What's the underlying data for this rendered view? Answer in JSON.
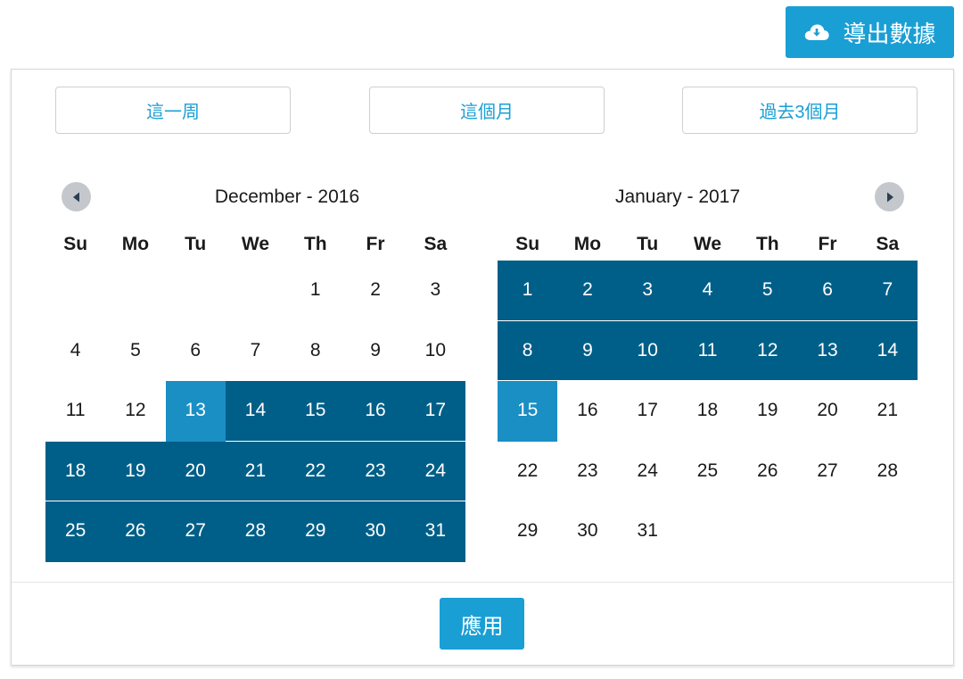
{
  "export_button": {
    "label": "導出數據",
    "icon": "cloud-download-icon"
  },
  "presets": [
    {
      "label": "這一周"
    },
    {
      "label": "這個月"
    },
    {
      "label": "過去3個月"
    }
  ],
  "nav": {
    "prev_icon": "triangle-left-icon",
    "next_icon": "triangle-right-icon"
  },
  "weekday_labels": [
    "Su",
    "Mo",
    "Tu",
    "We",
    "Th",
    "Fr",
    "Sa"
  ],
  "calendars": [
    {
      "title": "December - 2016",
      "weeks": [
        [
          "",
          "",
          "",
          "",
          "1",
          "2",
          "3"
        ],
        [
          "4",
          "5",
          "6",
          "7",
          "8",
          "9",
          "10"
        ],
        [
          "11",
          "12",
          "13",
          "14",
          "15",
          "16",
          "17"
        ],
        [
          "18",
          "19",
          "20",
          "21",
          "22",
          "23",
          "24"
        ],
        [
          "25",
          "26",
          "27",
          "28",
          "29",
          "30",
          "31"
        ]
      ],
      "range_start": "13",
      "range_end": "31"
    },
    {
      "title": "January - 2017",
      "weeks": [
        [
          "1",
          "2",
          "3",
          "4",
          "5",
          "6",
          "7"
        ],
        [
          "8",
          "9",
          "10",
          "11",
          "12",
          "13",
          "14"
        ],
        [
          "15",
          "16",
          "17",
          "18",
          "19",
          "20",
          "21"
        ],
        [
          "22",
          "23",
          "24",
          "25",
          "26",
          "27",
          "28"
        ],
        [
          "29",
          "30",
          "31",
          "",
          "",
          "",
          ""
        ]
      ],
      "range_start": "1",
      "range_end": "15"
    }
  ],
  "selection": {
    "start": "December 13, 2016",
    "end": "January 15, 2017"
  },
  "apply_button": {
    "label": "應用"
  },
  "colors": {
    "accent": "#1a9fd4",
    "range": "#005f88",
    "endpoint": "#1a8fc4",
    "nav_button": "#c4c8cc"
  }
}
